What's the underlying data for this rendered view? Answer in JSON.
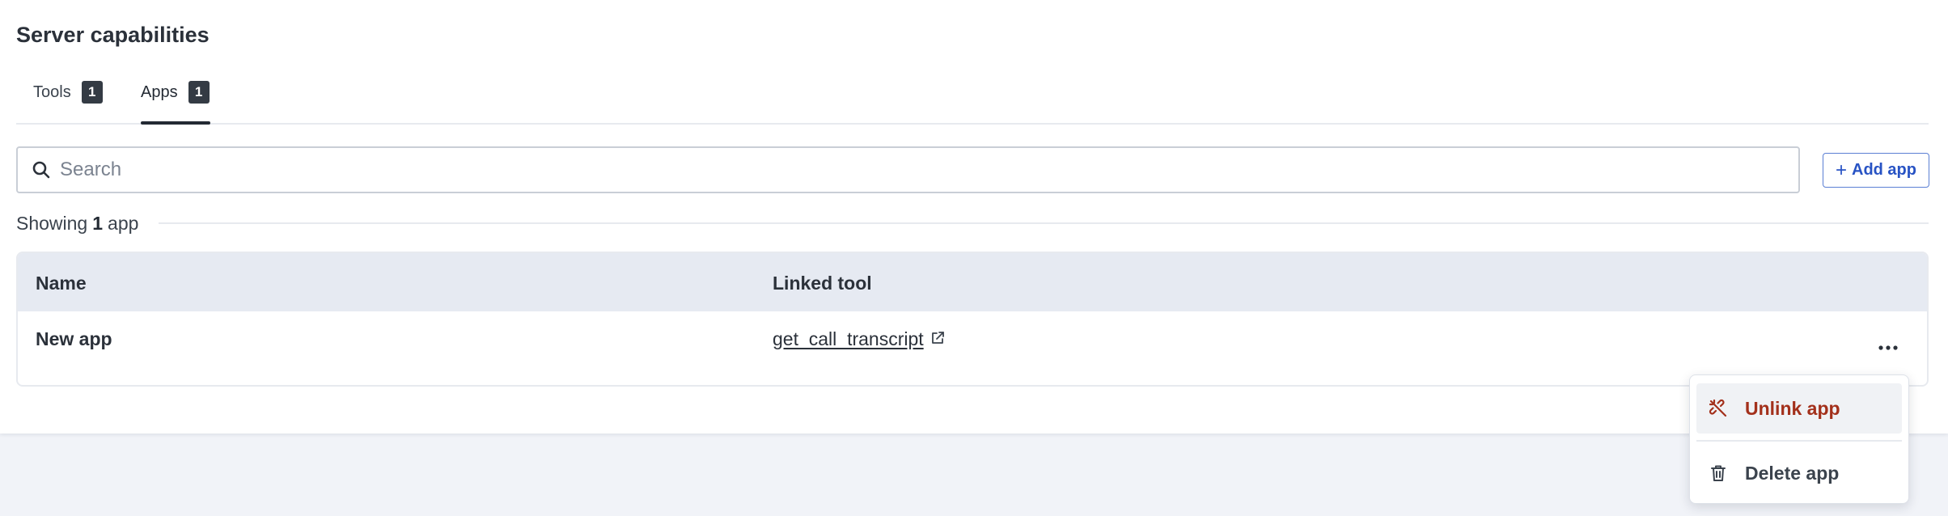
{
  "section": {
    "title": "Server capabilities"
  },
  "tabs": [
    {
      "label": "Tools",
      "count": "1"
    },
    {
      "label": "Apps",
      "count": "1"
    }
  ],
  "search": {
    "placeholder": "Search",
    "value": ""
  },
  "toolbar": {
    "add_app_label": "Add app",
    "add_icon": "plus-icon"
  },
  "summary": {
    "prefix": "Showing",
    "count": "1",
    "suffix": "app"
  },
  "table": {
    "columns": [
      "Name",
      "Linked tool"
    ],
    "rows": [
      {
        "name": "New app",
        "linked_tool": "get_call_transcript"
      }
    ],
    "row_actions_icon": "more-horizontal-icon"
  },
  "menu": {
    "items": [
      {
        "label": "Unlink app",
        "icon": "unlink-icon",
        "color": "#a3301b"
      },
      {
        "label": "Delete app",
        "icon": "trash-icon",
        "color": "#3b434d"
      }
    ]
  },
  "colors": {
    "accent": "#2853c4",
    "danger": "#a3301b",
    "badge": "#343b44",
    "header_bg": "#e6eaf2",
    "page_bg": "#f1f3f8"
  }
}
